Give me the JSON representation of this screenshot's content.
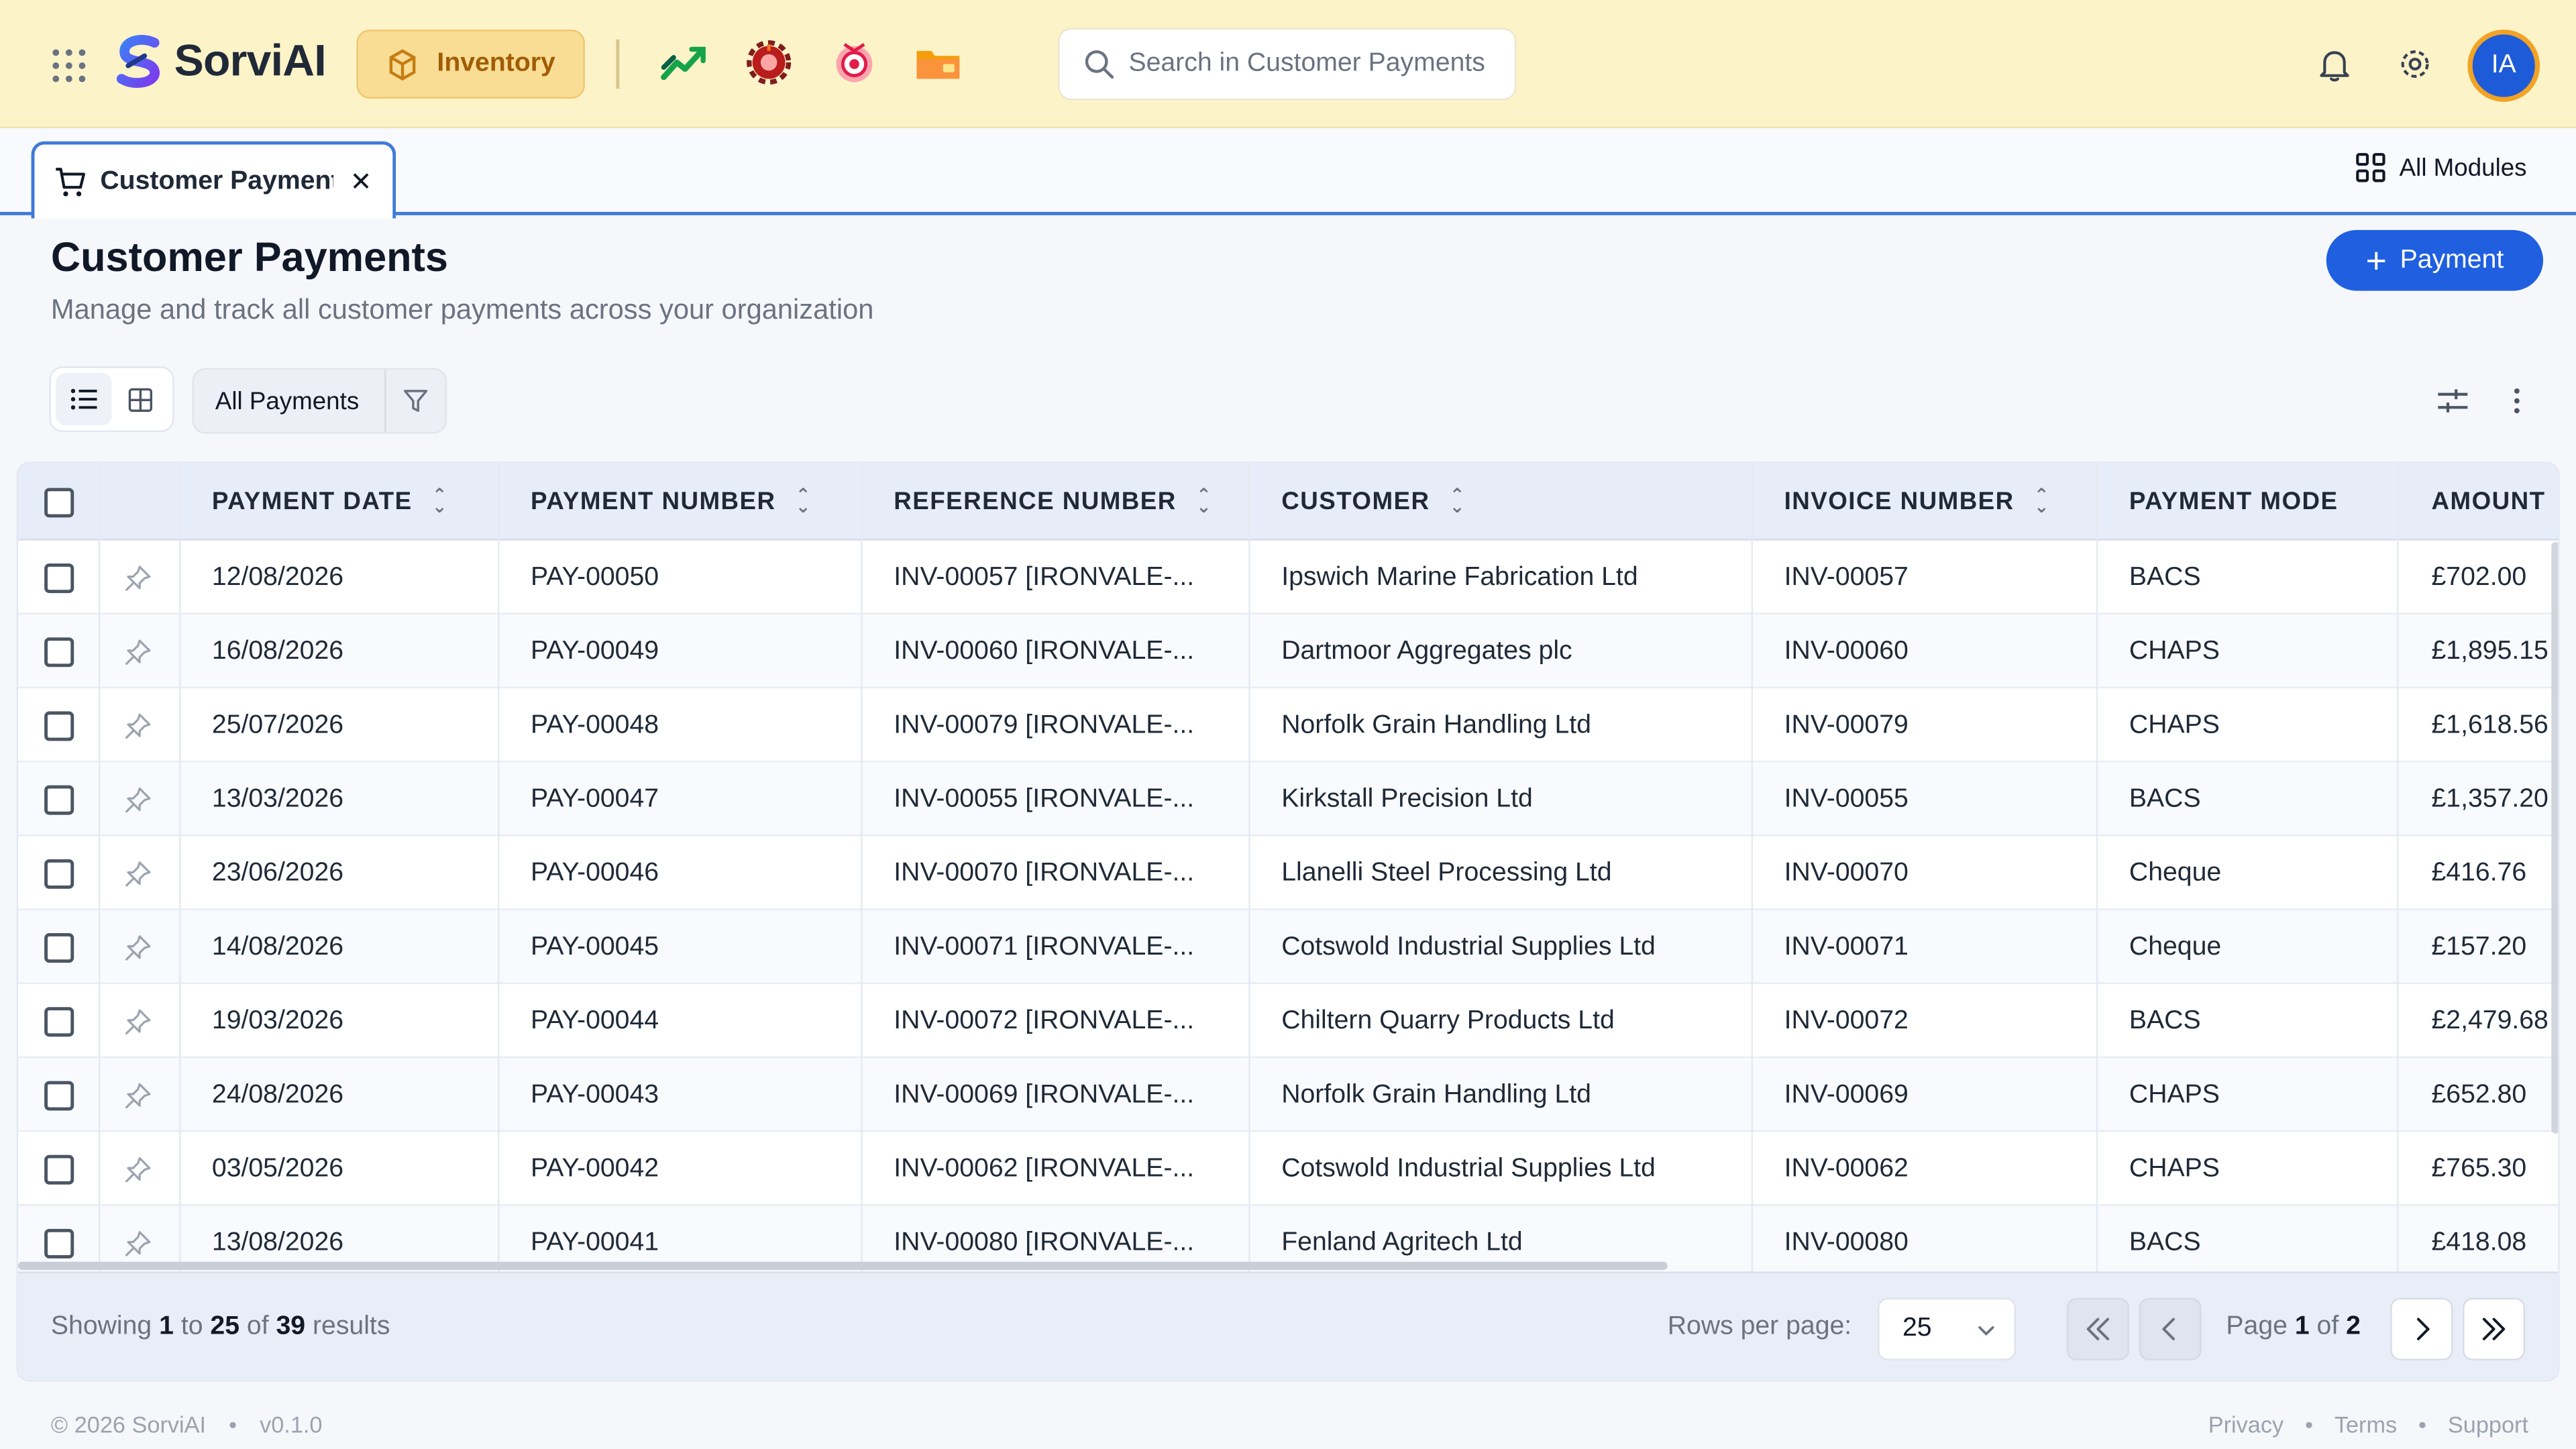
{
  "brand": {
    "name": "SorviAI"
  },
  "header": {
    "module_label": "Inventory",
    "search_placeholder": "Search in Customer Payments",
    "user_initials": "IA",
    "app_icons": [
      "chart-trend-icon",
      "gear-bug-icon",
      "target-badge-icon",
      "folder-icon"
    ]
  },
  "tabs": {
    "open_tab": "Customer Payments",
    "all_modules": "All Modules"
  },
  "page": {
    "title": "Customer Payments",
    "subtitle": "Manage and track all customer payments across your organization",
    "add_button": "Payment"
  },
  "toolbar": {
    "filter_label": "All Payments"
  },
  "table": {
    "columns": [
      "PAYMENT DATE",
      "PAYMENT NUMBER",
      "REFERENCE NUMBER",
      "CUSTOMER",
      "INVOICE NUMBER",
      "PAYMENT MODE",
      "AMOUNT"
    ],
    "rows": [
      [
        "12/08/2026",
        "PAY-00050",
        "INV-00057 [IRONVALE-...",
        "Ipswich Marine Fabrication Ltd",
        "INV-00057",
        "BACS",
        "£702.00"
      ],
      [
        "16/08/2026",
        "PAY-00049",
        "INV-00060 [IRONVALE-...",
        "Dartmoor Aggregates plc",
        "INV-00060",
        "CHAPS",
        "£1,895.15"
      ],
      [
        "25/07/2026",
        "PAY-00048",
        "INV-00079 [IRONVALE-...",
        "Norfolk Grain Handling Ltd",
        "INV-00079",
        "CHAPS",
        "£1,618.56"
      ],
      [
        "13/03/2026",
        "PAY-00047",
        "INV-00055 [IRONVALE-...",
        "Kirkstall Precision Ltd",
        "INV-00055",
        "BACS",
        "£1,357.20"
      ],
      [
        "23/06/2026",
        "PAY-00046",
        "INV-00070 [IRONVALE-...",
        "Llanelli Steel Processing Ltd",
        "INV-00070",
        "Cheque",
        "£416.76"
      ],
      [
        "14/08/2026",
        "PAY-00045",
        "INV-00071 [IRONVALE-...",
        "Cotswold Industrial Supplies Ltd",
        "INV-00071",
        "Cheque",
        "£157.20"
      ],
      [
        "19/03/2026",
        "PAY-00044",
        "INV-00072 [IRONVALE-...",
        "Chiltern Quarry Products Ltd",
        "INV-00072",
        "BACS",
        "£2,479.68"
      ],
      [
        "24/08/2026",
        "PAY-00043",
        "INV-00069 [IRONVALE-...",
        "Norfolk Grain Handling Ltd",
        "INV-00069",
        "CHAPS",
        "£652.80"
      ],
      [
        "03/05/2026",
        "PAY-00042",
        "INV-00062 [IRONVALE-...",
        "Cotswold Industrial Supplies Ltd",
        "INV-00062",
        "CHAPS",
        "£765.30"
      ],
      [
        "13/08/2026",
        "PAY-00041",
        "INV-00080 [IRONVALE-...",
        "Fenland Agritech Ltd",
        "INV-00080",
        "BACS",
        "£418.08"
      ]
    ]
  },
  "pagination": {
    "showing_prefix": "Showing",
    "from": "1",
    "to_word": "to",
    "to": "25",
    "of_word": "of",
    "total": "39",
    "results_word": "results",
    "rows_per_page_label": "Rows per page:",
    "rows_per_page_value": "25",
    "page_word": "Page",
    "current_page": "1",
    "page_of_word": "of",
    "total_pages": "2"
  },
  "footer": {
    "copyright": "© 2026 SorviAI",
    "version": "v0.1.0",
    "links": [
      "Privacy",
      "Terms",
      "Support"
    ]
  },
  "colors": {
    "header_bg": "#fdf3c9",
    "accent": "#1f5fe0",
    "module_chip": "#f9dd94",
    "table_header_bg": "#e6ecf8"
  }
}
